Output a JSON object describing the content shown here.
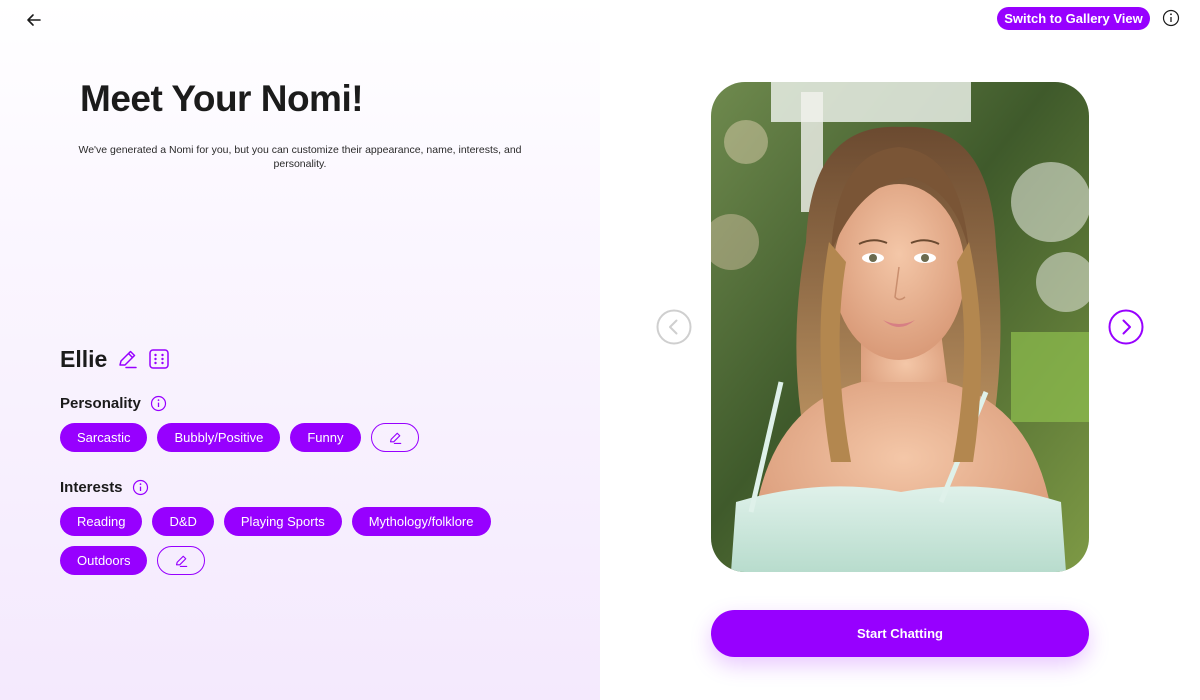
{
  "header": {
    "gallery_button_label": "Switch to Gallery View"
  },
  "intro": {
    "title": "Meet Your Nomi!",
    "subtitle": "We've generated a Nomi for you, but you can customize their appearance, name, interests, and personality."
  },
  "nomi": {
    "name": "Ellie"
  },
  "personality": {
    "label": "Personality",
    "traits": [
      "Sarcastic",
      "Bubbly/Positive",
      "Funny"
    ]
  },
  "interests": {
    "label": "Interests",
    "items": [
      "Reading",
      "D&D",
      "Playing Sports",
      "Mythology/folklore",
      "Outdoors"
    ]
  },
  "actions": {
    "start_label": "Start Chatting"
  },
  "icons": [
    "back-arrow-icon",
    "info-icon",
    "pencil-icon",
    "dice-icon",
    "chevron-left-icon",
    "chevron-right-icon"
  ],
  "colors": {
    "accent": "#9700ff",
    "text": "#1b1b1b",
    "panel_gradient_end": "#f4e9fd"
  }
}
